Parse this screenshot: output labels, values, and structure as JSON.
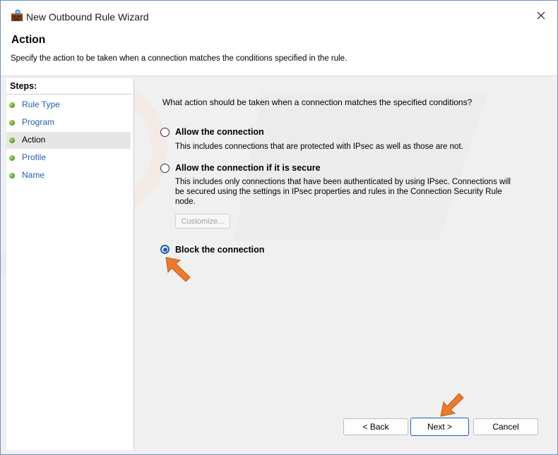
{
  "window": {
    "title": "New Outbound Rule Wizard",
    "icon": "firewall-wizard-icon",
    "close_icon": "close-icon"
  },
  "header": {
    "title": "Action",
    "description": "Specify the action to be taken when a connection matches the conditions specified in the rule."
  },
  "sidebar": {
    "label": "Steps:",
    "steps": [
      {
        "label": "Rule Type",
        "selected": false
      },
      {
        "label": "Program",
        "selected": false
      },
      {
        "label": "Action",
        "selected": true
      },
      {
        "label": "Profile",
        "selected": false
      },
      {
        "label": "Name",
        "selected": false
      }
    ]
  },
  "main": {
    "question": "What action should be taken when a connection matches the specified conditions?",
    "options": [
      {
        "label": "Allow the connection",
        "description": "This includes connections that are protected with IPsec as well as those are not.",
        "checked": false
      },
      {
        "label": "Allow the connection if it is secure",
        "description": "This includes only connections that have been authenticated by using IPsec.  Connections will be secured using the settings in IPsec properties and rules in the Connection Security Rule node.",
        "checked": false
      },
      {
        "label": "Block the connection",
        "description": "",
        "checked": true
      }
    ],
    "customize_label": "Customize..."
  },
  "buttons": {
    "back": "< Back",
    "next": "Next >",
    "cancel": "Cancel"
  },
  "colors": {
    "accent": "#1f5fb5",
    "arrow": "#ef7a29",
    "link": "#1f5fb5"
  }
}
